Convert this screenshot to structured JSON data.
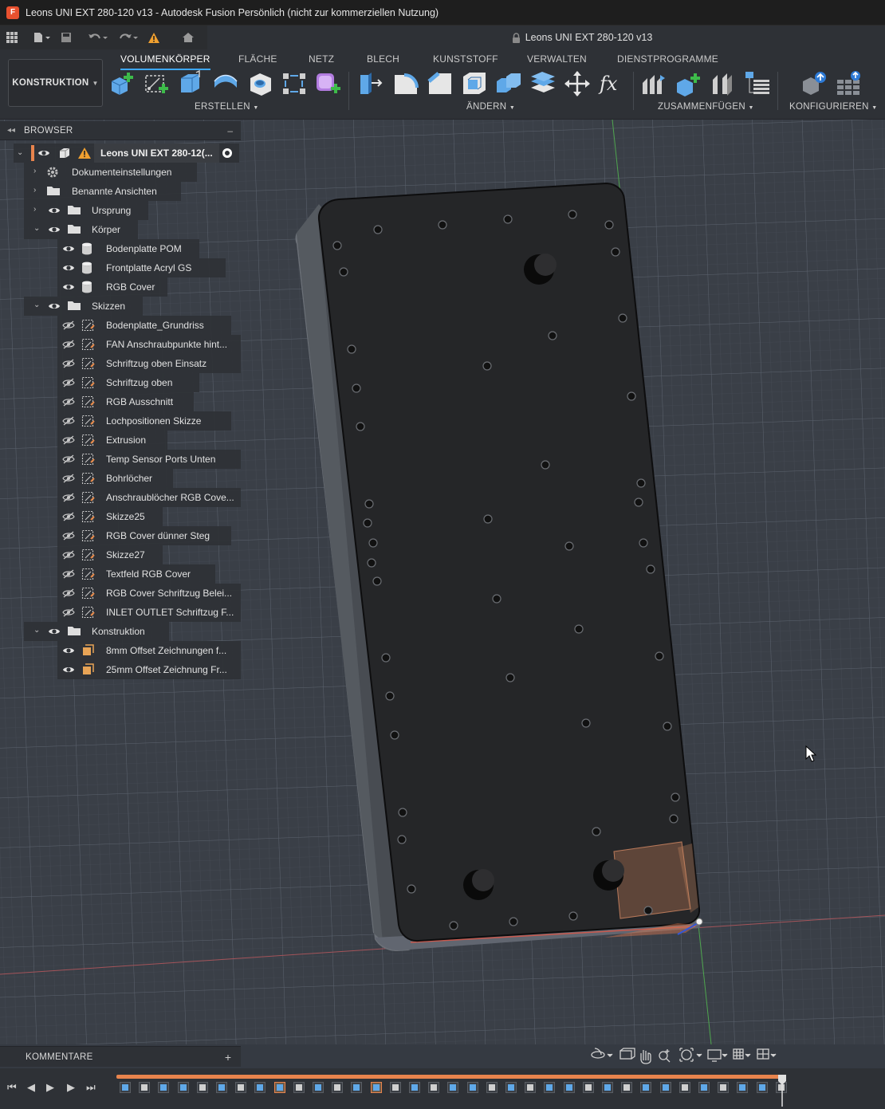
{
  "window": {
    "title": "Leons UNI EXT 280-120 v13 - Autodesk Fusion Persönlich (nicht zur kommerziellen Nutzung)"
  },
  "document_tab": {
    "title": "Leons UNI EXT 280-120 v13"
  },
  "workspace": {
    "label": "KONSTRUKTION"
  },
  "ribbon": {
    "tabs": [
      "VOLUMENKÖRPER",
      "FLÄCHE",
      "NETZ",
      "BLECH",
      "KUNSTSTOFF",
      "VERWALTEN",
      "DIENSTPROGRAMME"
    ],
    "active_tab": "VOLUMENKÖRPER",
    "groups": {
      "erstellen": "ERSTELLEN",
      "aendern": "ÄNDERN",
      "zusammenfuegen": "ZUSAMMENFÜGEN",
      "konfigurieren": "KONFIGURIEREN"
    },
    "accent": "#3ea8ff"
  },
  "browser": {
    "title": "BROWSER",
    "root": "Leons UNI EXT 280-12(...",
    "items": [
      {
        "label": "Dokumenteinstellungen",
        "type": "settings"
      },
      {
        "label": "Benannte Ansichten",
        "type": "folder"
      },
      {
        "label": "Ursprung",
        "type": "folder"
      },
      {
        "label": "Körper",
        "type": "folder"
      },
      {
        "label": "Bodenplatte POM",
        "type": "body"
      },
      {
        "label": "Frontplatte Acryl GS",
        "type": "body"
      },
      {
        "label": "RGB Cover",
        "type": "body"
      },
      {
        "label": "Skizzen",
        "type": "folder"
      },
      {
        "label": "Bodenplatte_Grundriss",
        "type": "sketch"
      },
      {
        "label": "FAN Anschraubpunkte hint...",
        "type": "sketch"
      },
      {
        "label": "Schriftzug oben Einsatz",
        "type": "sketch"
      },
      {
        "label": "Schriftzug oben",
        "type": "sketch"
      },
      {
        "label": "RGB Ausschnitt",
        "type": "sketch"
      },
      {
        "label": "Lochpositionen Skizze",
        "type": "sketch"
      },
      {
        "label": "Extrusion",
        "type": "sketch"
      },
      {
        "label": "Temp Sensor Ports Unten",
        "type": "sketch"
      },
      {
        "label": "Bohrlöcher",
        "type": "sketch"
      },
      {
        "label": "Anschraublöcher RGB Cove...",
        "type": "sketch"
      },
      {
        "label": "Skizze25",
        "type": "sketch"
      },
      {
        "label": "RGB Cover dünner Steg",
        "type": "sketch"
      },
      {
        "label": "Skizze27",
        "type": "sketch"
      },
      {
        "label": "Textfeld RGB Cover",
        "type": "sketch"
      },
      {
        "label": "RGB Cover Schriftzug Belei...",
        "type": "sketch"
      },
      {
        "label": "INLET OUTLET Schriftzug F...",
        "type": "sketch"
      },
      {
        "label": "Konstruktion",
        "type": "folder"
      },
      {
        "label": "8mm Offset Zeichnungen f...",
        "type": "plane"
      },
      {
        "label": "25mm Offset Zeichnung Fr...",
        "type": "plane"
      }
    ]
  },
  "comments": {
    "label": "KOMMENTARE",
    "add": "+"
  },
  "timeline": {
    "accent": "#e8844d"
  }
}
